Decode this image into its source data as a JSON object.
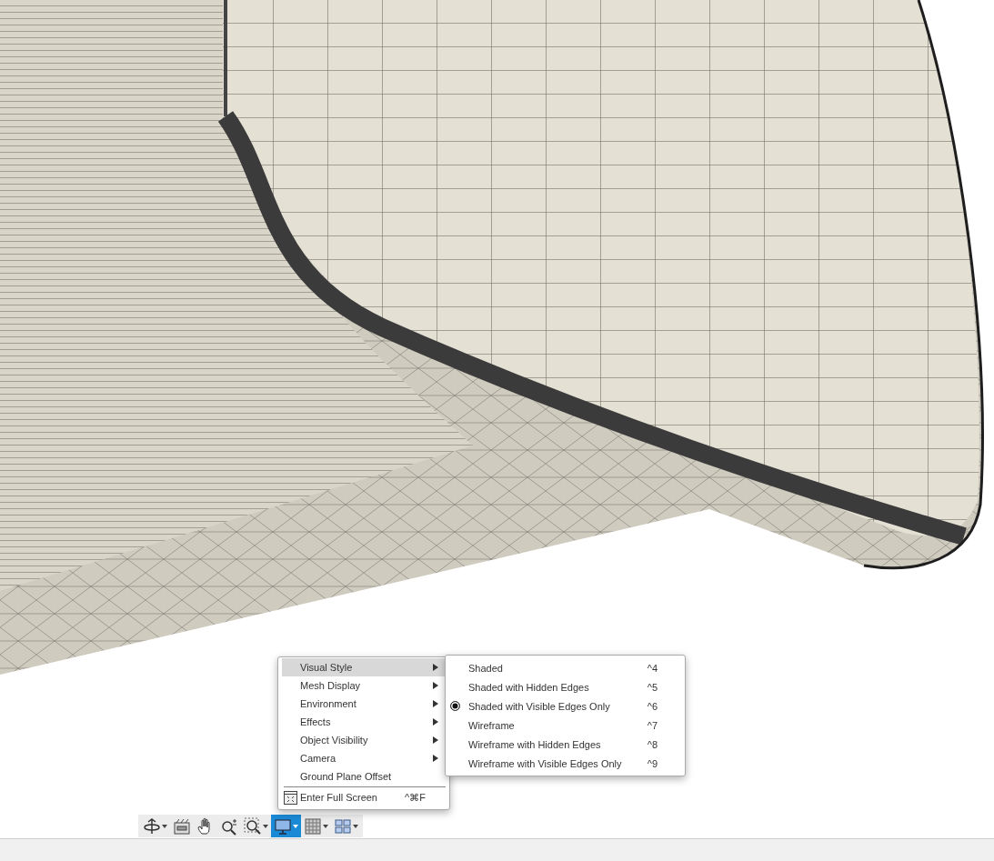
{
  "menu": {
    "items": [
      {
        "label": "Visual Style",
        "submenu": true,
        "selected": true
      },
      {
        "label": "Mesh Display",
        "submenu": true,
        "selected": false
      },
      {
        "label": "Environment",
        "submenu": true,
        "selected": false
      },
      {
        "label": "Effects",
        "submenu": true,
        "selected": false
      },
      {
        "label": "Object Visibility",
        "submenu": true,
        "selected": false
      },
      {
        "label": "Camera",
        "submenu": true,
        "selected": false
      },
      {
        "label": "Ground Plane Offset",
        "submenu": false,
        "selected": false
      }
    ],
    "footer": {
      "label": "Enter Full Screen",
      "shortcut": "^⌘F"
    }
  },
  "submenu": {
    "items": [
      {
        "label": "Shaded",
        "shortcut": "^4",
        "selected": false
      },
      {
        "label": "Shaded with Hidden Edges",
        "shortcut": "^5",
        "selected": false
      },
      {
        "label": "Shaded with Visible Edges Only",
        "shortcut": "^6",
        "selected": true
      },
      {
        "label": "Wireframe",
        "shortcut": "^7",
        "selected": false
      },
      {
        "label": "Wireframe with Hidden Edges",
        "shortcut": "^8",
        "selected": false
      },
      {
        "label": "Wireframe with Visible Edges Only",
        "shortcut": "^9",
        "selected": false
      }
    ]
  },
  "toolbar": {
    "tools": [
      {
        "kind": "orbit",
        "dropdown": true,
        "selected": false
      },
      {
        "kind": "look-at",
        "dropdown": false,
        "selected": false
      },
      {
        "kind": "pan",
        "dropdown": false,
        "selected": false
      },
      {
        "kind": "zoom",
        "dropdown": false,
        "selected": false
      },
      {
        "kind": "fit",
        "dropdown": true,
        "selected": false
      },
      {
        "kind": "display",
        "dropdown": true,
        "selected": true
      },
      {
        "kind": "grid",
        "dropdown": true,
        "selected": false
      },
      {
        "kind": "viewports",
        "dropdown": true,
        "selected": false
      }
    ]
  }
}
